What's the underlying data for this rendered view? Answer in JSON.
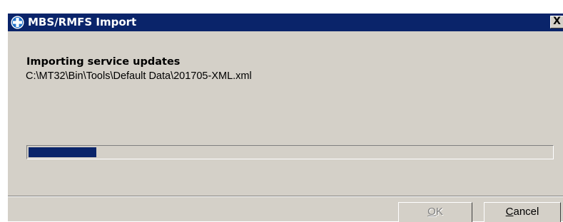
{
  "window": {
    "title": "MBS/RMFS Import",
    "title_icon": "app-cross-icon",
    "close_label": "X"
  },
  "content": {
    "heading": "Importing service updates",
    "file_path": "C:\\MT32\\Bin\\Tools\\Default Data\\201705-XML.xml"
  },
  "progress": {
    "fraction": 0.13
  },
  "buttons": {
    "ok": {
      "mnemonic": "O",
      "rest": "K",
      "enabled": false
    },
    "cancel": {
      "mnemonic": "C",
      "rest": "ancel",
      "enabled": true
    }
  },
  "colors": {
    "titlebar": "#0a246a",
    "face": "#d4d0c8",
    "progress_fill": "#0a246a"
  }
}
